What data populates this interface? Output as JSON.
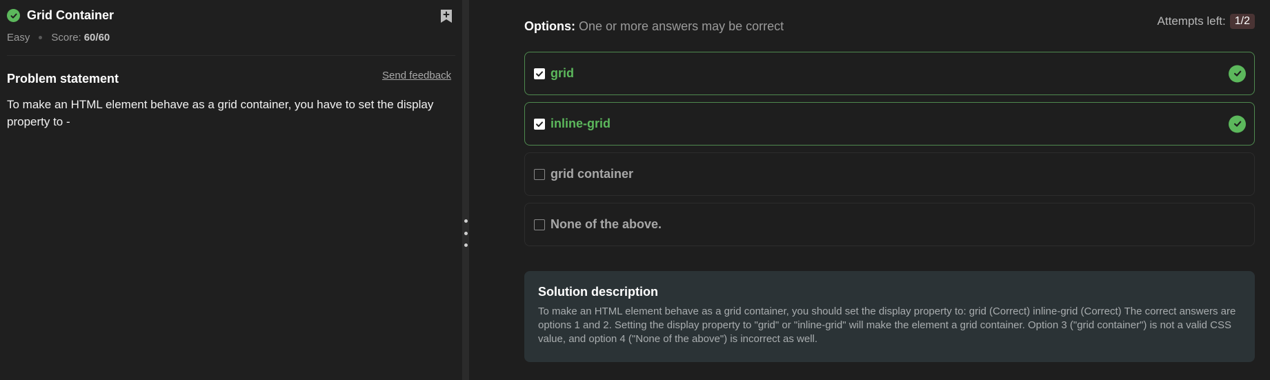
{
  "problem": {
    "title": "Grid Container",
    "difficulty": "Easy",
    "score_label": "Score:",
    "score_value": "60/60",
    "statement_heading": "Problem statement",
    "feedback_link": "Send feedback",
    "statement_text": "To make an HTML element behave as a grid container, you have to set the display property to -"
  },
  "quiz": {
    "options_label": "Options:",
    "options_hint": "One or more answers may be correct",
    "attempts_label": "Attempts left:",
    "attempts_value": "1/2",
    "options": [
      {
        "label": "grid",
        "checked": true,
        "correct": true
      },
      {
        "label": "inline-grid",
        "checked": true,
        "correct": true
      },
      {
        "label": "grid container",
        "checked": false,
        "correct": false
      },
      {
        "label": "None of the above.",
        "checked": false,
        "correct": false
      }
    ]
  },
  "solution": {
    "heading": "Solution description",
    "text": "To make an HTML element behave as a grid container, you should set the display property to: grid (Correct) inline-grid (Correct) The correct answers are options 1 and 2. Setting the display property to \"grid\" or \"inline-grid\" will make the element a grid container. Option 3 (\"grid container\") is not a valid CSS value, and option 4 (\"None of the above\") is incorrect as well."
  },
  "colors": {
    "success": "#5cb85c",
    "panel_bg": "#1f1f1f",
    "solution_bg": "#2b3336",
    "attempts_badge": "#4a3434"
  }
}
